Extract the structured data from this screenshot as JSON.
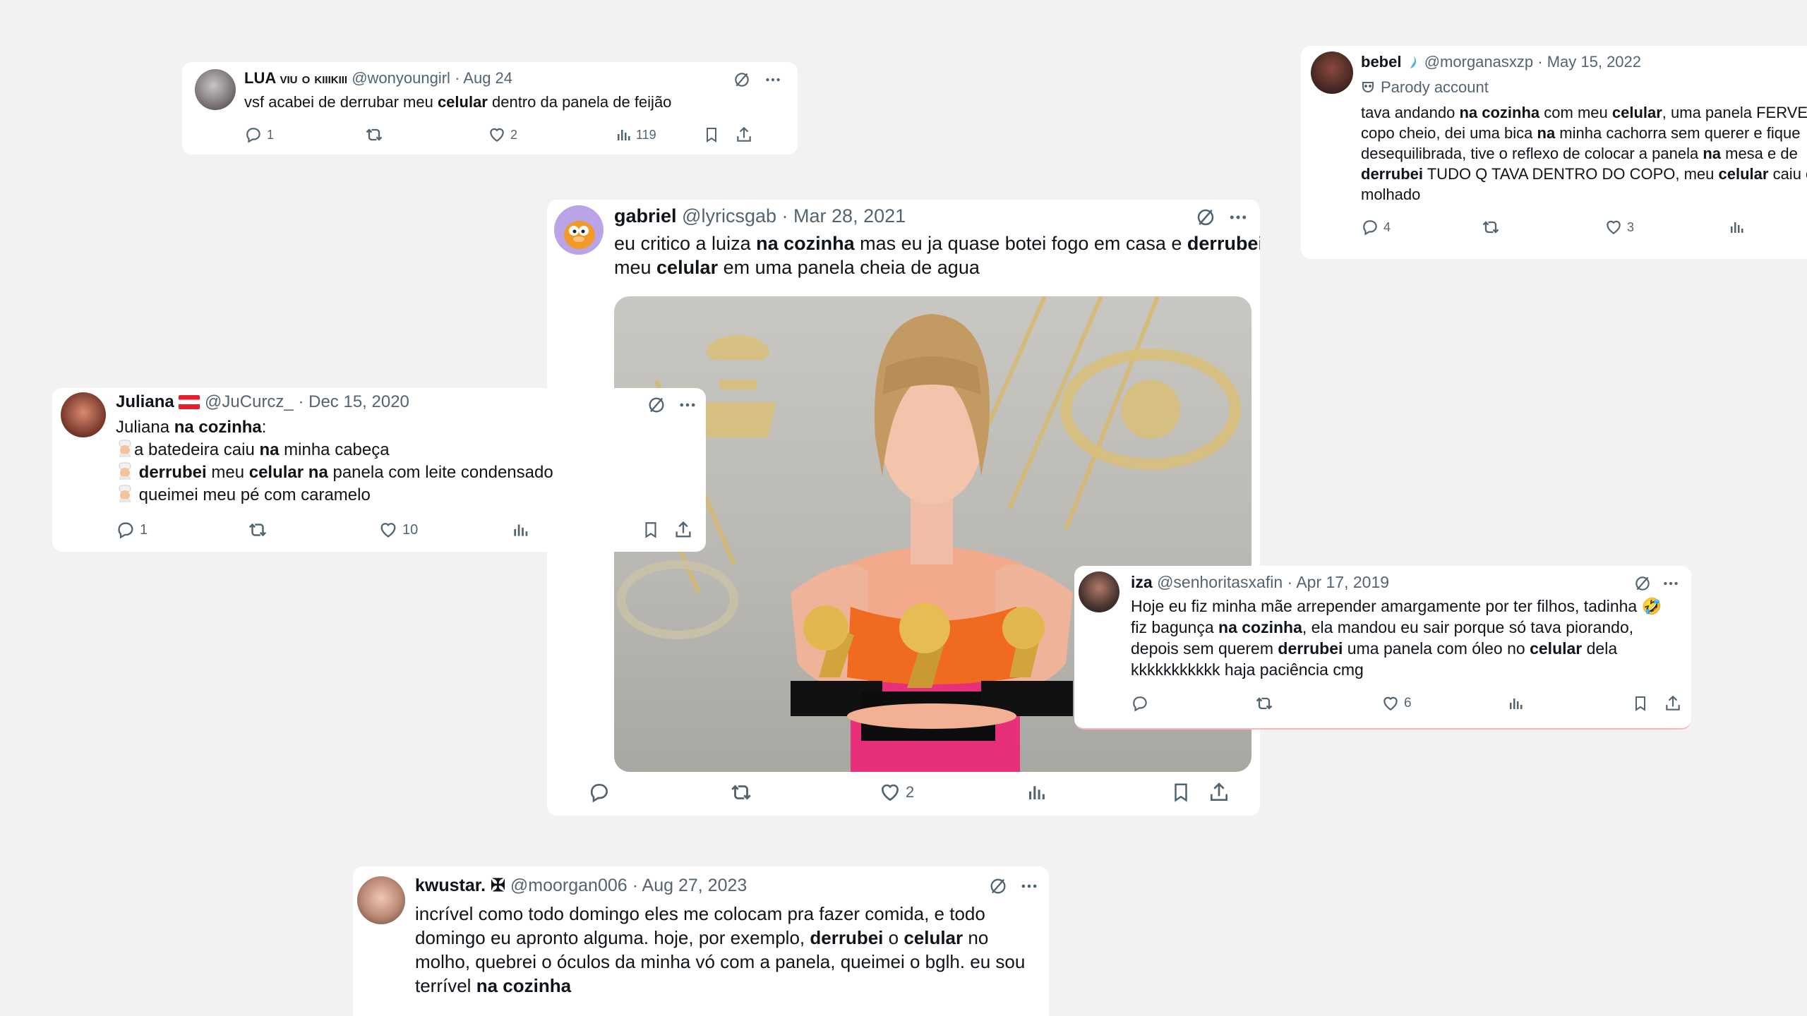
{
  "tweets": {
    "lua": {
      "name": "LUA viu o kiiikiii",
      "handle": "@wonyoungirl",
      "date": "Aug 24",
      "text_html": "vsf acabei de derrubar meu <b>celular</b> dentro da panela de feijão",
      "replies": "1",
      "likes": "2",
      "views": "119"
    },
    "bebel": {
      "name": "bebel",
      "handle": "@morganasxzp",
      "date": "May 15, 2022",
      "parody_label": "Parody account",
      "text_html": "tava andando <b>na cozinha</b> com meu <b>celular</b>, uma panela FERVE<br>copo cheio, dei uma bica <b>na</b> minha cachorra sem querer e fique<br>desequilibrada, tive o reflexo de colocar a panela <b>na</b> mesa e de<br><b>derrubei</b> TUDO Q TAVA DENTRO DO COPO, meu <b>celular</b> caiu e<br>molhado",
      "replies": "4",
      "likes": "3"
    },
    "gabriel": {
      "name": "gabriel",
      "handle": "@lyricsgab",
      "date": "Mar 28, 2021",
      "text_html": "eu critico a luiza <b>na cozinha</b> mas eu ja quase botei fogo em casa e <b>derrubei</b><br>meu <b>celular</b> em uma panela cheia de agua",
      "likes": "2"
    },
    "juliana": {
      "name": "Juliana",
      "handle": "@JuCurcz_",
      "date": "Dec 15, 2020",
      "lines_html": [
        "Juliana <b>na cozinha</b>:",
        "a batedeira caiu <b>na</b> minha cabeça",
        "<b>derrubei</b> meu <b>celular na</b> panela com leite condensado",
        "queimei meu pé com caramelo"
      ],
      "replies": "1",
      "likes": "10"
    },
    "iza": {
      "name": "iza",
      "handle": "@senhoritasxafin",
      "date": "Apr 17, 2019",
      "text_html": "Hoje eu fiz minha mãe arrepender amargamente por ter filhos, tadinha 🤣<br>fiz bagunça <b>na cozinha</b>, ela mandou eu sair porque só tava piorando,<br>depois sem querem <b>derrubei</b> uma panela com óleo no <b>celular</b> dela<br>kkkkkkkkkkk haja paciência cmg",
      "likes": "6"
    },
    "kwustar": {
      "name": "kwustar. ✠",
      "handle": "@moorgan006",
      "date": "Aug 27, 2023",
      "text_html": "incrível como todo domingo eles me colocam pra fazer comida, e todo<br>domingo eu apronto alguma. hoje, por exemplo, <b>derrubei</b> o <b>celular</b> no<br>molho, quebrei o óculos da minha vó com a panela, queimei o bglh. eu sou<br>terrível <b>na cozinha</b>"
    }
  },
  "sep": "·",
  "colors": {
    "bg": "#f2f2f2",
    "text": "#0f1419",
    "muted": "#536471",
    "verified": "#1d9bf0"
  }
}
